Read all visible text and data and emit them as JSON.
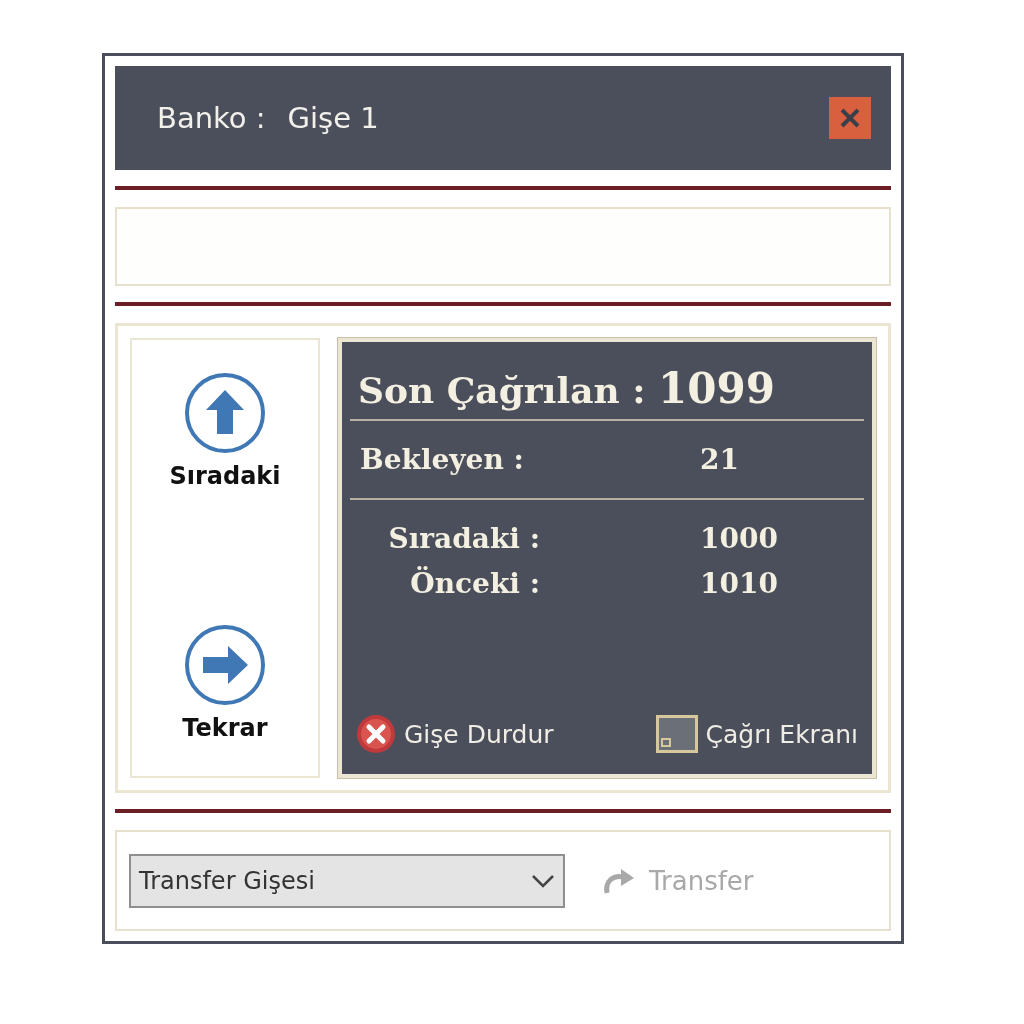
{
  "window": {
    "title_label": "Banko :",
    "title_value": "Gişe 1"
  },
  "actions": [
    {
      "kind": "up",
      "label": "Sıradaki"
    },
    {
      "kind": "right",
      "label": "Tekrar"
    }
  ],
  "status": {
    "last_called_label": "Son Çağrılan :",
    "last_called_value": "1099",
    "waiting_label": "Bekleyen :",
    "waiting_value": "21",
    "rows": [
      {
        "label": "Sıradaki :",
        "value": "1000"
      },
      {
        "label": "Önceki :",
        "value": "1010"
      }
    ],
    "buttons": [
      {
        "kind": "stop",
        "label": "Gişe Durdur"
      },
      {
        "kind": "screen",
        "label": "Çağrı Ekranı"
      }
    ]
  },
  "transfer": {
    "select_value": "Transfer Gişesi",
    "button_label": "Transfer",
    "disabled": true
  }
}
